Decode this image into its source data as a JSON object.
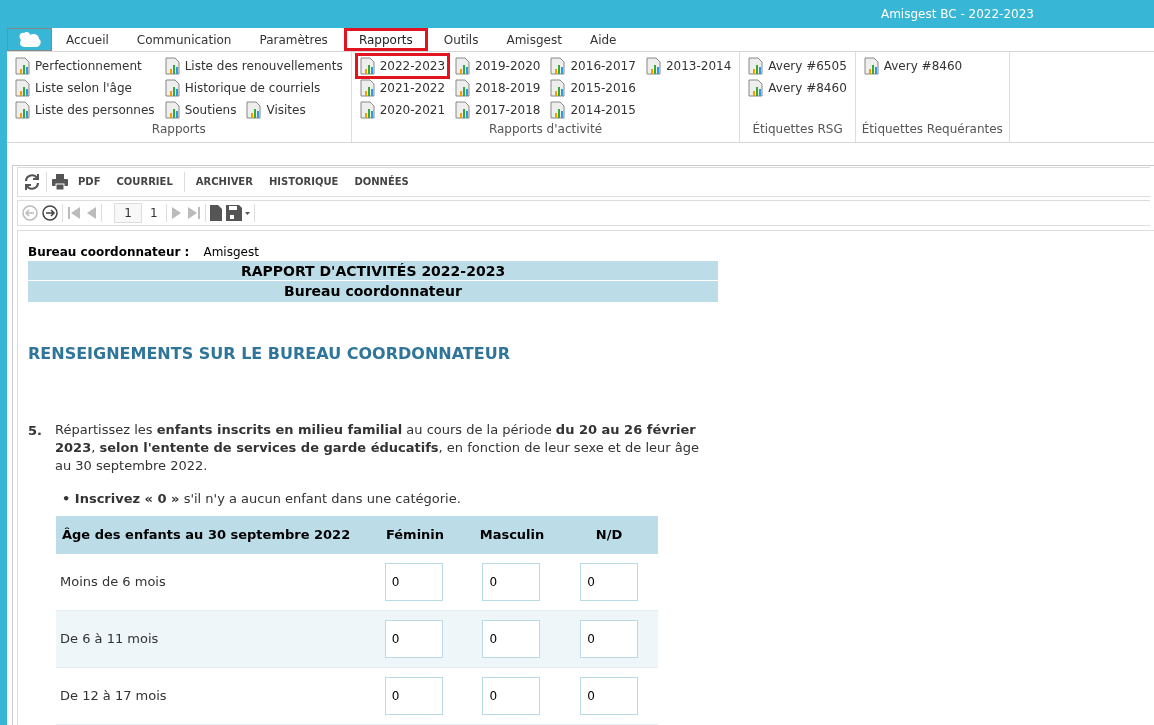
{
  "window": {
    "title": "Amisgest BC - 2022-2023"
  },
  "tabs": [
    {
      "label": "Accueil",
      "selected": false,
      "highlighted": false
    },
    {
      "label": "Communication",
      "selected": false,
      "highlighted": false
    },
    {
      "label": "Paramètres",
      "selected": false,
      "highlighted": false
    },
    {
      "label": "Rapports",
      "selected": true,
      "highlighted": true
    },
    {
      "label": "Outils",
      "selected": false,
      "highlighted": false
    },
    {
      "label": "Amisgest",
      "selected": false,
      "highlighted": false
    },
    {
      "label": "Aide",
      "selected": false,
      "highlighted": false
    }
  ],
  "ribbon_groups": [
    {
      "title": "Rapports",
      "columns": [
        [
          [
            {
              "label": "Perfectionnement",
              "highlighted": false
            }
          ],
          [
            {
              "label": "Liste selon l'âge",
              "highlighted": false
            }
          ],
          [
            {
              "label": "Liste des personnes",
              "highlighted": false
            }
          ]
        ],
        [
          [
            {
              "label": "Liste des renouvellements",
              "highlighted": false
            }
          ],
          [
            {
              "label": "Historique de courriels",
              "highlighted": false
            }
          ],
          [
            {
              "label": "Soutiens",
              "highlighted": false
            },
            {
              "label": "Visites",
              "highlighted": false
            }
          ]
        ]
      ]
    },
    {
      "title": "Rapports d'activité",
      "columns": [
        [
          [
            {
              "label": "2022-2023",
              "highlighted": true
            }
          ],
          [
            {
              "label": "2021-2022",
              "highlighted": false
            }
          ],
          [
            {
              "label": "2020-2021",
              "highlighted": false
            }
          ]
        ],
        [
          [
            {
              "label": "2019-2020",
              "highlighted": false
            }
          ],
          [
            {
              "label": "2018-2019",
              "highlighted": false
            }
          ],
          [
            {
              "label": "2017-2018",
              "highlighted": false
            }
          ]
        ],
        [
          [
            {
              "label": "2016-2017",
              "highlighted": false
            }
          ],
          [
            {
              "label": "2015-2016",
              "highlighted": false
            }
          ],
          [
            {
              "label": "2014-2015",
              "highlighted": false
            }
          ]
        ],
        [
          [
            {
              "label": "2013-2014",
              "highlighted": false
            }
          ]
        ]
      ]
    },
    {
      "title": "Étiquettes RSG",
      "columns": [
        [
          [
            {
              "label": "Avery #6505",
              "highlighted": false
            }
          ],
          [
            {
              "label": "Avery #8460",
              "highlighted": false
            }
          ]
        ]
      ]
    },
    {
      "title": "Étiquettes Requérantes",
      "columns": [
        [
          [
            {
              "label": "Avery #8460",
              "highlighted": false
            }
          ]
        ]
      ]
    }
  ],
  "toolbar": {
    "buttons": [
      "PDF",
      "COURRIEL",
      "ARCHIVER",
      "HISTORIQUE",
      "DONNÉES"
    ],
    "page_field": "1",
    "page_count": "1"
  },
  "report": {
    "office_label": "Bureau coordonnateur :",
    "office_value": "Amisgest",
    "title": "RAPPORT D'ACTIVITÉS 2022-2023",
    "subtitle": "Bureau coordonnateur",
    "section_heading": "RENSEIGNEMENTS SUR LE BUREAU COORDONNATEUR",
    "question_number": "5.",
    "question_text": "Répartissez les **enfants inscrits en milieu familial** au cours de la période **du 20 au 26 février 2023**, **selon l'entente de services de garde éducatifs**, en fonction de leur sexe et de leur âge au 30 septembre 2022.",
    "instruction": "**• Inscrivez « 0 »** s'il n'y a aucun enfant dans une catégorie.",
    "table": {
      "columns": [
        "Âge des enfants au 30 septembre 2022",
        "Féminin",
        "Masculin",
        "N/D"
      ],
      "rows": [
        {
          "label": "Moins de 6 mois",
          "values": [
            "0",
            "0",
            "0"
          ]
        },
        {
          "label": "De 6 à 11 mois",
          "values": [
            "0",
            "0",
            "0"
          ]
        },
        {
          "label": "De 12 à 17 mois",
          "values": [
            "0",
            "0",
            "0"
          ]
        }
      ]
    }
  }
}
